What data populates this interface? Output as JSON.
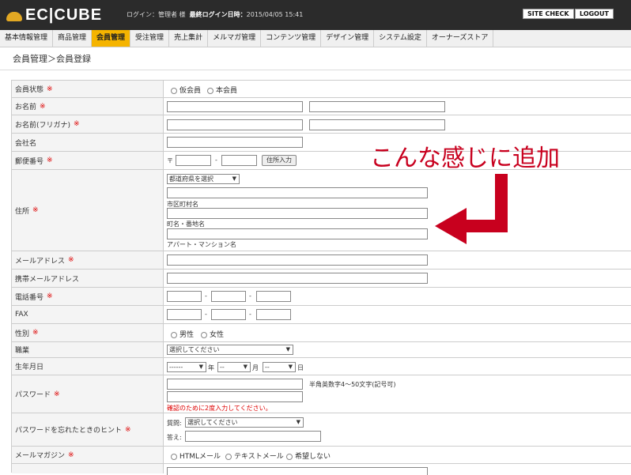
{
  "header": {
    "logo": "EC|CUBE",
    "login_label": "ログイン：",
    "login_user": "管理者 様",
    "last_login_label": "最終ログイン日時：",
    "last_login_value": "2015/04/05 15:41",
    "site_check": "SITE CHECK",
    "logout": "LOGOUT"
  },
  "menu": [
    "基本情報管理",
    "商品管理",
    "会員管理",
    "受注管理",
    "売上集計",
    "メルマガ管理",
    "コンテンツ管理",
    "デザイン管理",
    "システム設定",
    "オーナーズストア"
  ],
  "menu_active": "会員管理",
  "breadcrumb": "会員管理＞会員登録",
  "form": {
    "status_label": "会員状態",
    "status_options": [
      "仮会員",
      "本会員"
    ],
    "name_label": "お名前",
    "kana_label": "お名前(フリガナ)",
    "company_label": "会社名",
    "zip_label": "郵便番号",
    "zip_prefix": "〒",
    "zip_sep": "-",
    "zip_button": "住所入力",
    "address_label": "住所",
    "pref_select": "都道府県を選択",
    "city_hint": "市区町村名",
    "street_hint": "町名・番地名",
    "building_hint": "アパート・マンション名",
    "email_label": "メールアドレス",
    "mobile_email_label": "携帯メールアドレス",
    "tel_label": "電話番号",
    "fax_label": "FAX",
    "dash": "-",
    "sex_label": "性別",
    "sex_options": [
      "男性",
      "女性"
    ],
    "job_label": "職業",
    "job_select": "選択してください",
    "birth_label": "生年月日",
    "birth_year": "------",
    "birth_month": "--",
    "birth_day": "--",
    "birth_y": "年",
    "birth_m": "月",
    "birth_d": "日",
    "password_label": "パスワード",
    "password_note": "半角英数字4～50文字(記号可)",
    "password_confirm": "確認のために2度入力してください。",
    "hint_label": "パスワードを忘れたときのヒント",
    "hint_q_label": "質問:",
    "hint_select": "選択してください",
    "hint_a_label": "答え:",
    "mail_label": "メールマガジン",
    "mail_options": [
      "HTMLメール",
      "テキストメール",
      "希望しない"
    ]
  },
  "annotation": "こんな感じに追加",
  "required_mark": "※",
  "colors": {
    "annotation": "#c8001e",
    "active_menu": "#f5b400"
  }
}
